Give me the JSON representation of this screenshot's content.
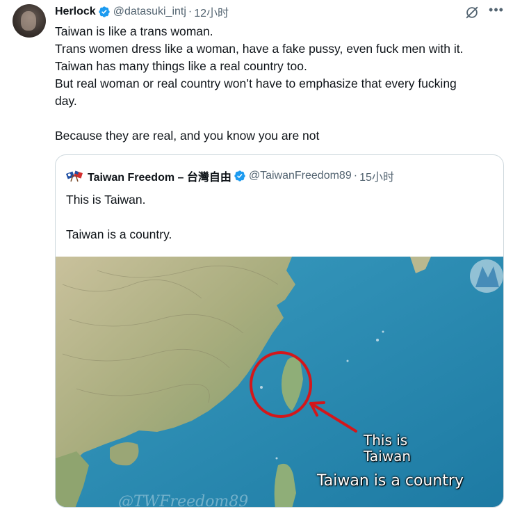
{
  "tweet": {
    "author_name": "Herlock",
    "author_handle": "@datasuki_intj",
    "separator": "·",
    "time": "12小时",
    "lines": [
      "Taiwan is like a trans woman.",
      "Trans women dress like a woman, have a fake pussy, even fuck men with it.",
      "Taiwan has many things like a real country too.",
      "But real woman or real country won’t have to emphasize that every fucking",
      "day.",
      "",
      "Because they are real, and you know you are not"
    ]
  },
  "quoted_tweet": {
    "author_name": "Taiwan Freedom – 台灣自由",
    "author_handle": "@TaiwanFreedom89",
    "separator": "·",
    "time": "15小时",
    "lines": [
      "This is Taiwan.",
      "",
      "Taiwan is a country."
    ],
    "image": {
      "label_line1": "This is",
      "label_line2": "Taiwan",
      "caption": "Taiwan is a country",
      "watermark": "@TWFreedom89"
    }
  },
  "icons": {
    "verified": "verified-badge-icon",
    "grok": "grok-icon",
    "more": "more-options-icon",
    "flag": "flags-icon"
  },
  "colors": {
    "verified_blue": "#1d9bf0",
    "secondary_text": "#536471",
    "circle_red": "#d3171b",
    "sea": "#2f8fb3"
  }
}
